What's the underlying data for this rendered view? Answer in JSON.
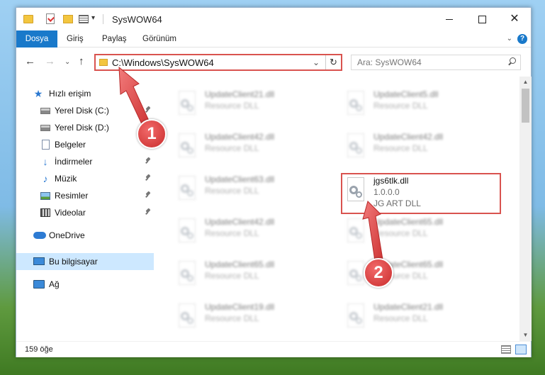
{
  "window": {
    "title": "SysWOW64",
    "minimize_icon": "minimize-icon",
    "maximize_icon": "maximize-icon",
    "close_glyph": "✕"
  },
  "quick_access_toolbar": {
    "caret": "▾"
  },
  "ribbon": {
    "tabs": [
      "Dosya",
      "Giriş",
      "Paylaş",
      "Görünüm"
    ],
    "expand_glyph": "⌄",
    "help_glyph": "?",
    "accent_color": "#1979ca"
  },
  "navigation": {
    "back_glyph": "←",
    "forward_glyph": "→",
    "recent_glyph": "⌄",
    "up_glyph": "↑",
    "address": "C:\\Windows\\SysWOW64",
    "address_dropdown_glyph": "⌄",
    "refresh_glyph": "↻",
    "search_placeholder": "Ara: SysWOW64"
  },
  "sidebar": {
    "quick_access": "Hızlı erişim",
    "items": [
      {
        "label": "Yerel Disk (C:)",
        "pinned": true
      },
      {
        "label": "Yerel Disk (D:)",
        "pinned": false
      },
      {
        "label": "Belgeler",
        "pinned": true
      },
      {
        "label": "İndirmeler",
        "pinned": true
      },
      {
        "label": "Müzik",
        "pinned": true
      },
      {
        "label": "Resimler",
        "pinned": true
      },
      {
        "label": "Videolar",
        "pinned": true
      }
    ],
    "onedrive": "OneDrive",
    "this_pc": "Bu bilgisayar",
    "network": "Ağ"
  },
  "files": {
    "left_column": [
      {
        "name": "UpdateClient21.dll",
        "type": "Resource DLL"
      },
      {
        "name": "UpdateClient42.dll",
        "type": "Resource DLL"
      },
      {
        "name": "UpdateClient63.dll",
        "type": "Resource DLL"
      },
      {
        "name": "UpdateClient42.dll",
        "type": "Resource DLL"
      },
      {
        "name": "UpdateClient65.dll",
        "type": "Resource DLL"
      },
      {
        "name": "UpdateClient19.dll",
        "type": "Resource DLL"
      }
    ],
    "right_column": [
      {
        "name": "UpdateClient5.dll",
        "type": "Resource DLL"
      },
      {
        "name": "UpdateClient42.dll",
        "type": "Resource DLL"
      },
      {
        "name": "UpdateClient65.dll",
        "type": "Resource DLL"
      },
      {
        "name": "UpdateClient65.dll",
        "type": "Resource DLL"
      },
      {
        "name": "UpdateClient21.dll",
        "type": "Resource DLL"
      }
    ],
    "highlighted": {
      "name": "jgs6tlk.dll",
      "version": "1.0.0.0",
      "type": "JG ART DLL"
    }
  },
  "scrollbar": {
    "up_glyph": "▲",
    "down_glyph": "▼"
  },
  "status": {
    "item_count": "159 öğe"
  },
  "annotations": {
    "step1": "1",
    "step2": "2",
    "highlight_color": "#d9534f"
  }
}
